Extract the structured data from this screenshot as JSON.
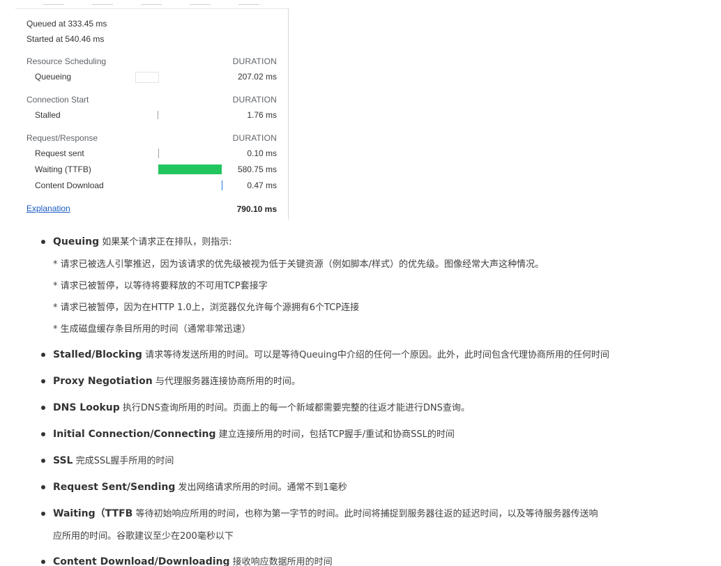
{
  "timing": {
    "queued_at": "Queued at 333.45 ms",
    "started_at": "Started at 540.46 ms",
    "sections": [
      {
        "title": "Resource Scheduling",
        "duration_label": "DURATION",
        "rows": [
          {
            "label": "Queueing",
            "value": "207.02 ms"
          }
        ]
      },
      {
        "title": "Connection Start",
        "duration_label": "DURATION",
        "rows": [
          {
            "label": "Stalled",
            "value": "1.76 ms"
          }
        ]
      },
      {
        "title": "Request/Response",
        "duration_label": "DURATION",
        "rows": [
          {
            "label": "Request sent",
            "value": "0.10 ms"
          },
          {
            "label": "Waiting (TTFB)",
            "value": "580.75 ms"
          },
          {
            "label": "Content Download",
            "value": "0.47 ms"
          }
        ]
      }
    ],
    "explanation_link": "Explanation",
    "total": "790.10 ms",
    "colors": {
      "ttfb_bar": "#22c55e",
      "download_bar": "#1a73e8",
      "link": "#1a5bc4"
    }
  },
  "explanations": [
    {
      "term": "Queuing",
      "desc": " 如果某个请求正在排队，则指示:",
      "subs": [
        "* 请求已被选人引擎推迟，因为该请求的优先级被视为低于关键资源（例如脚本/样式）的优先级。图像经常大声这种情况。",
        "* 请求已被暂停，以等待将要释放的不可用TCP套接字",
        "* 请求已被暂停，因为在HTTP 1.0上，浏览器仅允许每个源拥有6个TCP连接",
        "* 生成磁盘缓存条目所用的时间（通常非常迅速）"
      ]
    },
    {
      "term": "Stalled/Blocking",
      "desc": " 请求等待发送所用的时间。可以是等待Queuing中介绍的任何一个原因。此外，此时间包含代理协商所用的任何时间"
    },
    {
      "term": "Proxy Negotiation",
      "desc": " 与代理服务器连接协商所用的时间。"
    },
    {
      "term": "DNS Lookup",
      "desc": " 执行DNS查询所用的时间。页面上的每一个新域都需要完整的往返才能进行DNS查询。"
    },
    {
      "term": "Initial Connection/Connecting",
      "desc": " 建立连接所用的时间，包括TCP握手/重试和协商SSL的时间"
    },
    {
      "term": "SSL",
      "desc": " 完成SSL握手所用的时间"
    },
    {
      "term": "Request Sent/Sending",
      "desc": " 发出网络请求所用的时间。通常不到1毫秒"
    },
    {
      "term": "Waiting（TTFB",
      "desc": " 等待初始响应所用的时间，也称为第一字节的时间。此时间将捕捉到服务器往返的延迟时间，以及等待服务器传送响",
      "desc2": "应所用的时间。谷歌建议至少在200毫秒以下"
    },
    {
      "term": "Content Download/Downloading",
      "desc": " 接收响应数据所用的时间"
    }
  ]
}
